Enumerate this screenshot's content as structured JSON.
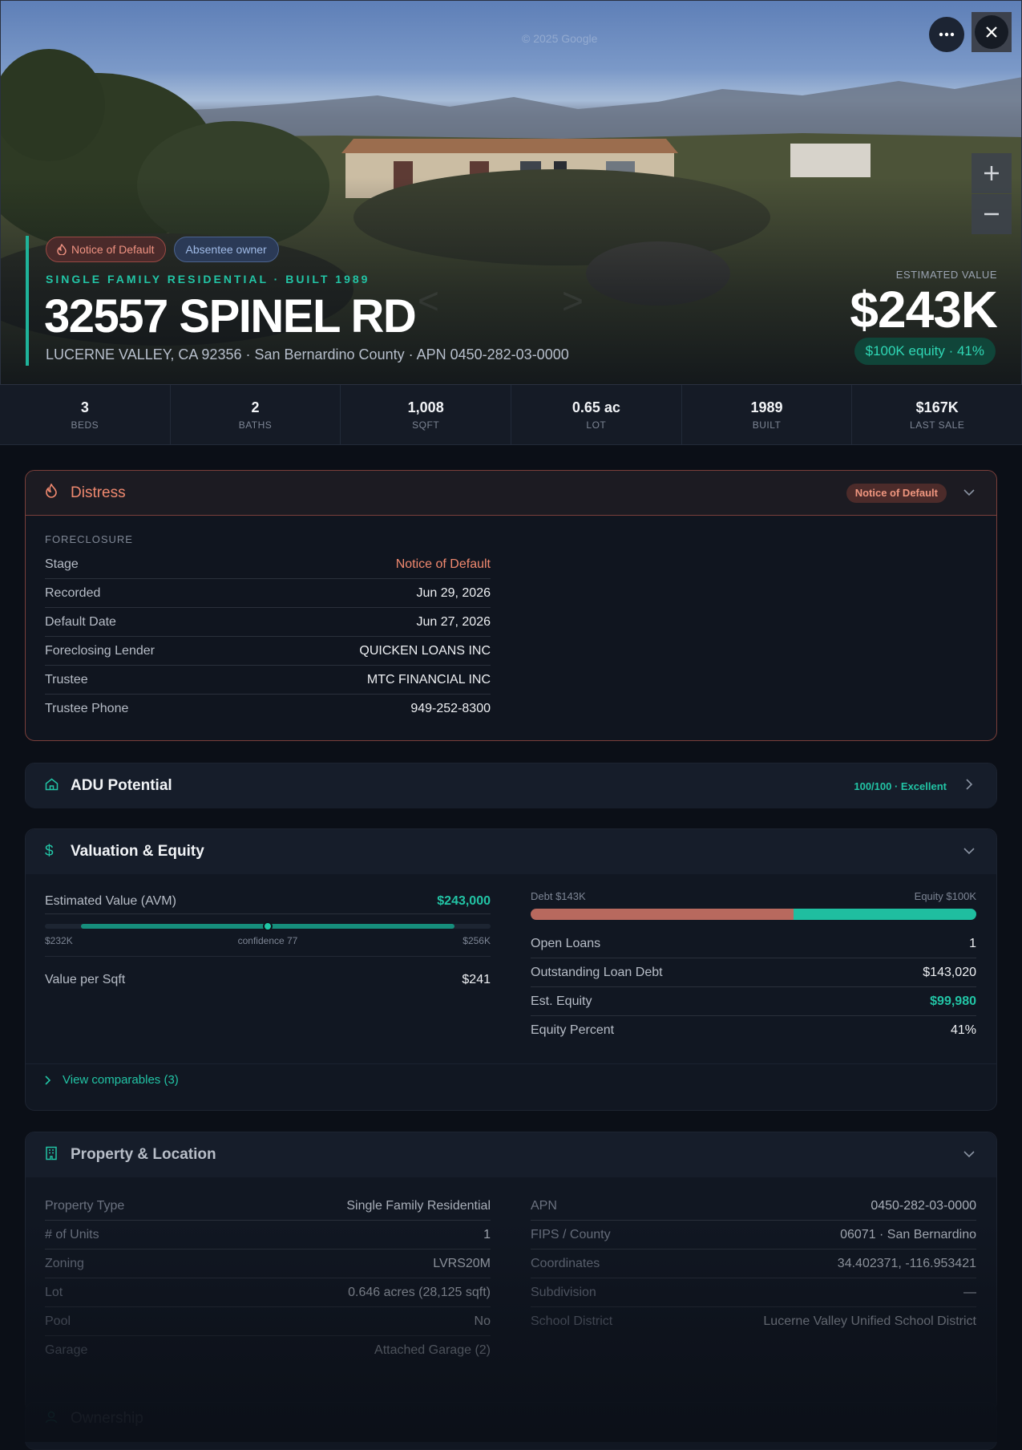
{
  "hero": {
    "badges": [
      "Notice of Default",
      "Absentee owner"
    ],
    "eyebrow": "SINGLE FAMILY RESIDENTIAL · BUILT 1989",
    "address": "32557 SPINEL RD",
    "subline": "LUCERNE VALLEY, CA 92356 · San Bernardino County · APN 0450-282-03-0000",
    "estimated_value_label": "ESTIMATED VALUE",
    "estimated_value": "$243K",
    "equity_pill": "$100K equity · 41%",
    "watermark": "© 2025 Google",
    "icons": {
      "more": "more-icon",
      "close": "close-icon",
      "zoom_in": "zoom-in-icon",
      "zoom_out": "zoom-out-icon",
      "flame": "flame-icon"
    }
  },
  "stats": [
    {
      "value": "3",
      "label": "BEDS"
    },
    {
      "value": "2",
      "label": "BATHS"
    },
    {
      "value": "1,008",
      "label": "SQFT"
    },
    {
      "value": "0.65 ac",
      "label": "LOT"
    },
    {
      "value": "1989",
      "label": "BUILT"
    },
    {
      "value": "$167K",
      "label": "LAST SALE"
    }
  ],
  "distress": {
    "title": "Distress",
    "badge": "Notice of Default",
    "section_label": "FORECLOSURE",
    "rows": [
      {
        "k": "Stage",
        "v": "Notice of Default"
      },
      {
        "k": "Recorded",
        "v": "Jun 29, 2026"
      },
      {
        "k": "Default Date",
        "v": "Jun 27, 2026"
      },
      {
        "k": "Foreclosing Lender",
        "v": "QUICKEN LOANS INC"
      },
      {
        "k": "Trustee",
        "v": "MTC FINANCIAL INC"
      },
      {
        "k": "Trustee Phone",
        "v": "949-252-8300"
      }
    ]
  },
  "adu": {
    "title": "ADU Potential",
    "score": "100/100 · Excellent"
  },
  "valuation": {
    "title": "Valuation & Equity",
    "avm_label": "Estimated Value (AVM)",
    "avm_value": "$243,000",
    "range_low": "$232K",
    "range_high": "$256K",
    "confidence": "confidence 77",
    "range_position": 0.5,
    "value_per_sqft_label": "Value per Sqft",
    "value_per_sqft": "$241",
    "debt_label": "Debt $143K",
    "equity_label": "Equity $100K",
    "debt_fraction": 0.59,
    "rows": [
      {
        "k": "Open Loans",
        "v": "1"
      },
      {
        "k": "Outstanding Loan Debt",
        "v": "$143,020"
      },
      {
        "k": "Est. Equity",
        "v": "$99,980"
      },
      {
        "k": "Equity Percent",
        "v": "41%"
      }
    ],
    "view_comparables": "View comparables (3)"
  },
  "property": {
    "title": "Property & Location",
    "left": [
      {
        "k": "Property Type",
        "v": "Single Family Residential"
      },
      {
        "k": "# of Units",
        "v": "1"
      },
      {
        "k": "Zoning",
        "v": "LVRS20M"
      },
      {
        "k": "Lot",
        "v": "0.646 acres (28,125 sqft)"
      },
      {
        "k": "Pool",
        "v": "No"
      },
      {
        "k": "Garage",
        "v": "Attached Garage (2)"
      }
    ],
    "right": [
      {
        "k": "APN",
        "v": "0450-282-03-0000"
      },
      {
        "k": "FIPS / County",
        "v": "06071 · San Bernardino"
      },
      {
        "k": "Coordinates",
        "v": "34.402371, -116.953421"
      },
      {
        "k": "Subdivision",
        "v": "—"
      },
      {
        "k": "School District",
        "v": "Lucerne Valley Unified School District"
      }
    ]
  },
  "ownership": {
    "title": "Ownership"
  },
  "colors": {
    "accent": "#1fb39a",
    "distress": "#f0896f",
    "debt": "#b8695e",
    "equity": "#1fbea0"
  }
}
